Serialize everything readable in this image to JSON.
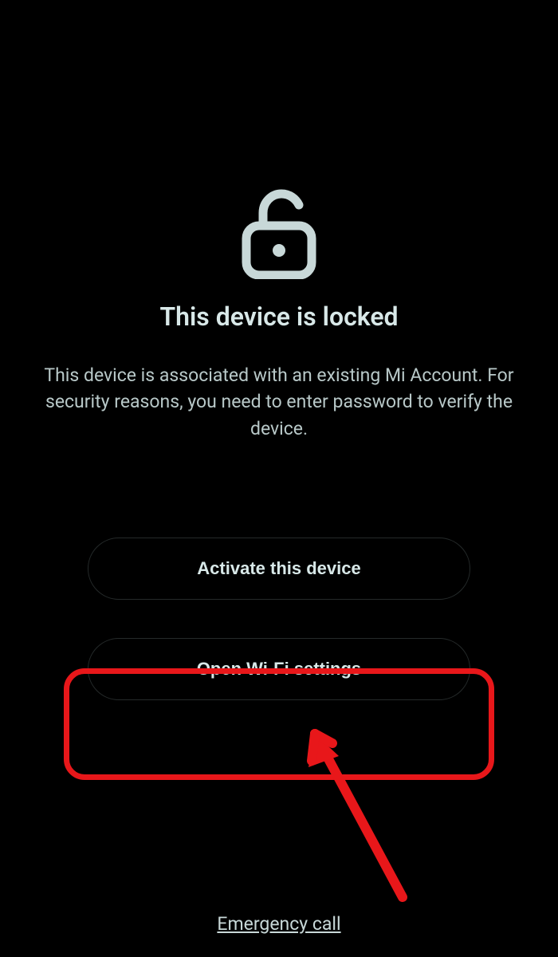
{
  "title": "This device is locked",
  "description": "This device is associated with an existing Mi Account. For security reasons, you need to enter password to verify the device.",
  "buttons": {
    "activate": "Activate this device",
    "wifi": "Open Wi-Fi settings"
  },
  "emergency": "Emergency call",
  "icon": "unlock-icon",
  "colors": {
    "highlight": "#e8171a",
    "text_primary": "#d8e8e8",
    "text_secondary": "#b8c8c8"
  }
}
